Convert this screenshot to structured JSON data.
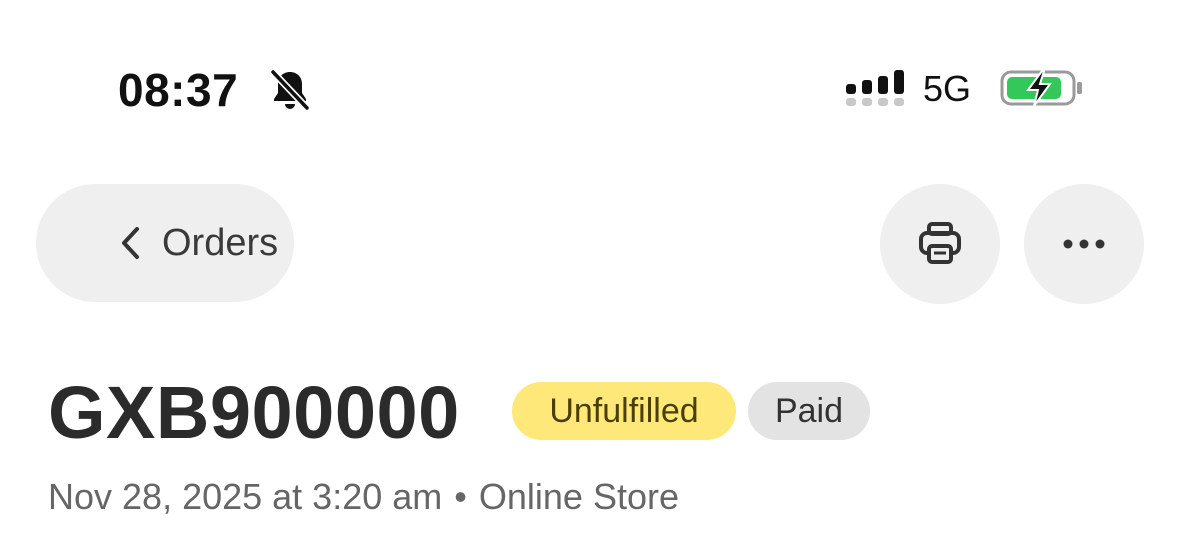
{
  "status_bar": {
    "time": "08:37",
    "network": "5G",
    "icons": {
      "bell": "bell-slash-icon",
      "signal": "cellular-signal-icon",
      "battery": "battery-charging-icon"
    },
    "battery_color": "#34c759"
  },
  "nav": {
    "back_label": "Orders",
    "print_icon": "printer-icon",
    "more_icon": "more-horizontal-icon"
  },
  "order": {
    "id": "GXB900000",
    "badges": [
      {
        "label": "Unfulfilled",
        "color": "#ffe87a"
      },
      {
        "label": "Paid",
        "color": "#e3e3e3"
      }
    ],
    "date": "Nov 28, 2025 at 3:20 am",
    "separator": "•",
    "channel": "Online Store"
  }
}
